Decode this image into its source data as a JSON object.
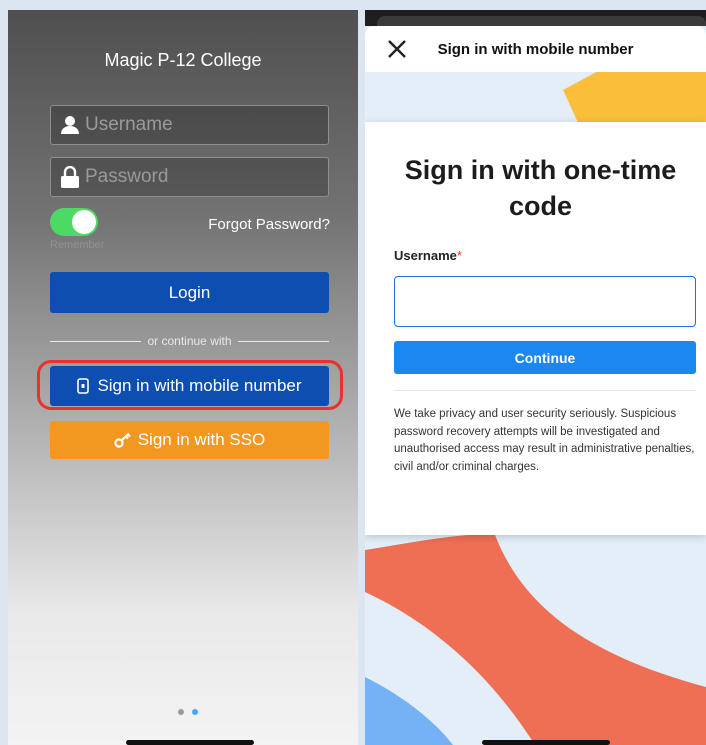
{
  "left_screen": {
    "college_name": "Magic P-12 College",
    "username_placeholder": "Username",
    "password_placeholder": "Password",
    "remember_label": "Remember",
    "remember_on": true,
    "forgot_password": "Forgot Password?",
    "login_label": "Login",
    "divider_text": "or continue with",
    "mobile_button_label": "Sign in with mobile number",
    "sso_button_label": "Sign in with SSO",
    "page_indicator": {
      "total": 2,
      "active": 2
    }
  },
  "right_screen": {
    "header_title": "Sign in with mobile number",
    "card_title": "Sign in with one-time code",
    "username_label": "Username",
    "required_marker": "*",
    "username_value": "",
    "continue_label": "Continue",
    "privacy_text": "We take privacy and user security seriously. Suspicious password recovery attempts will be investigated and unauthorised access may result in administrative penalties, civil and/or criminal charges."
  },
  "colors": {
    "primary_blue": "#0d4fb0",
    "sso_orange": "#f29820",
    "highlight_red": "#e8322c",
    "continue_blue": "#1a88f0",
    "toggle_green": "#4cd964",
    "deco_yellow": "#f9bf3b",
    "deco_coral": "#ef6f55",
    "deco_blue": "#74b1f5"
  },
  "icons": {
    "username": "person-icon",
    "password": "lock-icon",
    "mobile": "phone-icon",
    "sso": "key-icon",
    "close": "close-icon"
  }
}
